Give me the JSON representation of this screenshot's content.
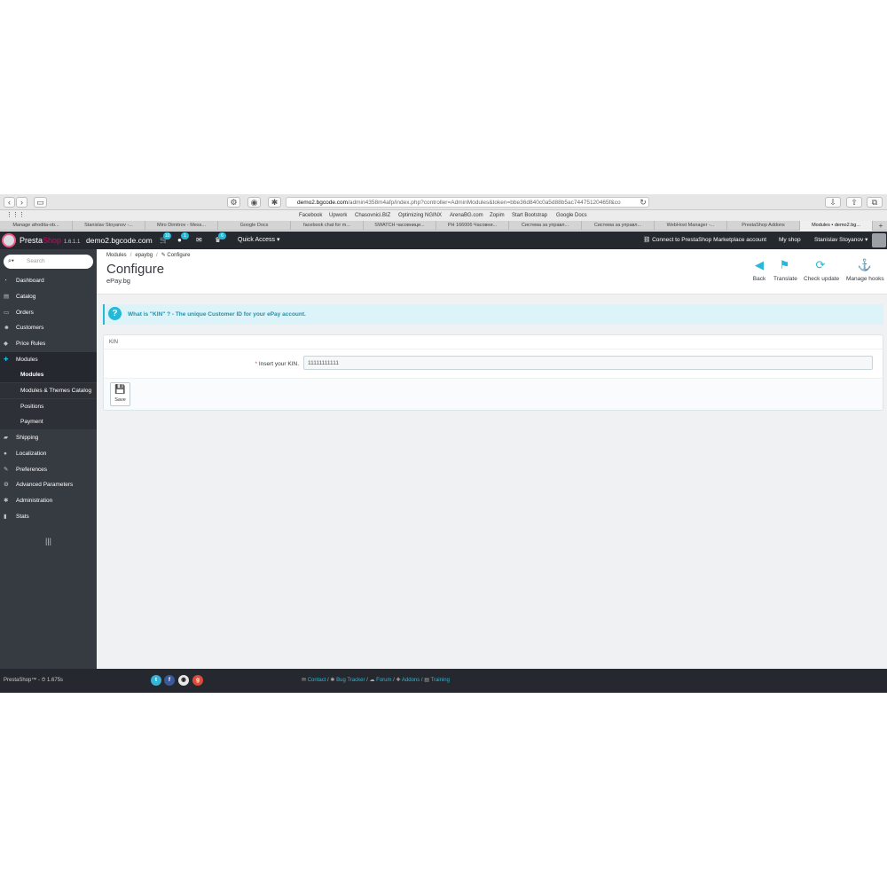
{
  "browser": {
    "url_domain": "demo2.bgcode.com",
    "url_path": "/admin4358m4afp/index.php?controller=AdminModules&token=bbe36d840c0a5d88b5ac74475120465f&co",
    "bookmarks": [
      "Facebook",
      "Upwork",
      "Chasovnici.BIZ",
      "Optimizing NGINX",
      "ArenaBG.com",
      "Zopim",
      "Start Bootstrap",
      "Google Docs"
    ],
    "tabs": [
      {
        "label": "Manage afrodita-ob..."
      },
      {
        "label": "Stanislav Stoyanov -..."
      },
      {
        "label": "Miro Dimitrov - Mess..."
      },
      {
        "label": "Google Docs"
      },
      {
        "label": "facebook chat for m..."
      },
      {
        "label": "SWATCH часовници..."
      },
      {
        "label": "PH 166006 Часовни..."
      },
      {
        "label": "Система за управл..."
      },
      {
        "label": "Система за управл..."
      },
      {
        "label": "WebHost Manager -..."
      },
      {
        "label": "PrestaShop Addons"
      },
      {
        "label": "Modules • demo2.bg..."
      }
    ]
  },
  "header": {
    "brand_presta": "Presta",
    "brand_shop": "Shop",
    "version": "1.6.1.1",
    "domain": "demo2.bgcode.com",
    "cart_badge": "10",
    "customers_badge": "1",
    "trophy_badge": "6",
    "quick_access": "Quick Access ▾",
    "marketplace": "Connect to PrestaShop Marketplace account",
    "my_shop": "My shop",
    "user": "Stanislav Stoyanov ▾"
  },
  "sidebar": {
    "search_placeholder": "Search",
    "items": [
      {
        "label": "Dashboard",
        "icon": "dashboard-icon"
      },
      {
        "label": "Catalog",
        "icon": "book-icon"
      },
      {
        "label": "Orders",
        "icon": "credit-card-icon"
      },
      {
        "label": "Customers",
        "icon": "users-icon"
      },
      {
        "label": "Price Rules",
        "icon": "tags-icon"
      },
      {
        "label": "Modules",
        "icon": "puzzle-icon"
      },
      {
        "label": "Shipping",
        "icon": "truck-icon"
      },
      {
        "label": "Localization",
        "icon": "globe-icon"
      },
      {
        "label": "Preferences",
        "icon": "wrench-icon"
      },
      {
        "label": "Advanced Parameters",
        "icon": "cogs-icon"
      },
      {
        "label": "Administration",
        "icon": "gear-icon"
      },
      {
        "label": "Stats",
        "icon": "bar-chart-icon"
      }
    ],
    "sub_items": [
      {
        "label": "Modules"
      },
      {
        "label": "Modules & Themes Catalog"
      },
      {
        "label": "Positions"
      },
      {
        "label": "Payment"
      }
    ]
  },
  "toolbar": {
    "breadcrumb": [
      "Modules",
      "epaybg",
      "Configure"
    ],
    "title": "Configure",
    "subtitle": "ePay.bg",
    "buttons": [
      {
        "label": "Back",
        "icon": "arrow-circle-left-icon"
      },
      {
        "label": "Translate",
        "icon": "flag-icon"
      },
      {
        "label": "Check update",
        "icon": "refresh-icon"
      },
      {
        "label": "Manage hooks",
        "icon": "anchor-icon"
      }
    ]
  },
  "alert": {
    "text": "What is \"KIN\" ? - The unique Customer ID for your ePay account."
  },
  "form": {
    "panel_title": "KIN",
    "required_mark": "*",
    "kin_label": "Insert your KIN.",
    "kin_value": "11111111111",
    "save_label": "Save"
  },
  "footer": {
    "left": "PrestaShop™ - ⏱ 1.675s",
    "links": [
      "Contact",
      "Bug Tracker",
      "Forum",
      "Addons",
      "Training"
    ]
  },
  "colors": {
    "accent": "#25b9d7",
    "sidebar": "#363a41",
    "header": "#25282e",
    "brand_pink": "#df0067"
  }
}
